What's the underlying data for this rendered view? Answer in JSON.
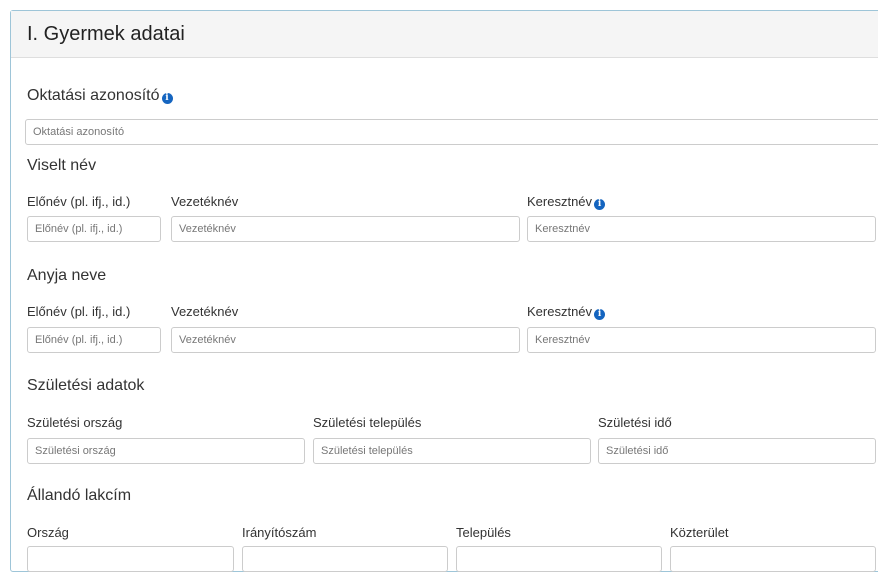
{
  "panel": {
    "title": "I. Gyermek adatai"
  },
  "oktatasi": {
    "label": "Oktatási azonosító",
    "placeholder": "Oktatási azonosító",
    "info_icon": "info-icon"
  },
  "viselt": {
    "title": "Viselt név",
    "prefix_label": "Előnév (pl. ifj., id.)",
    "prefix_placeholder": "Előnév (pl. ifj., id.)",
    "last_label": "Vezetéknév",
    "last_placeholder": "Vezetéknév",
    "first_label": "Keresztnév",
    "first_placeholder": "Keresztnév"
  },
  "anyja": {
    "title": "Anyja neve",
    "prefix_label": "Előnév (pl. ifj., id.)",
    "prefix_placeholder": "Előnév (pl. ifj., id.)",
    "last_label": "Vezetéknév",
    "last_placeholder": "Vezetéknév",
    "first_label": "Keresztnév",
    "first_placeholder": "Keresztnév"
  },
  "szuletesi": {
    "title": "Születési adatok",
    "country_label": "Születési ország",
    "country_placeholder": "Születési ország",
    "city_label": "Születési település",
    "city_placeholder": "Születési település",
    "date_label": "Születési idő",
    "date_placeholder": "Születési idő"
  },
  "lakcim": {
    "title": "Állandó lakcím",
    "country_label": "Ország",
    "zip_label": "Irányítószám",
    "city_label": "Település",
    "street_label": "Közterület"
  },
  "colors": {
    "accent": "#1565c0",
    "border": "#9ec5d8"
  }
}
